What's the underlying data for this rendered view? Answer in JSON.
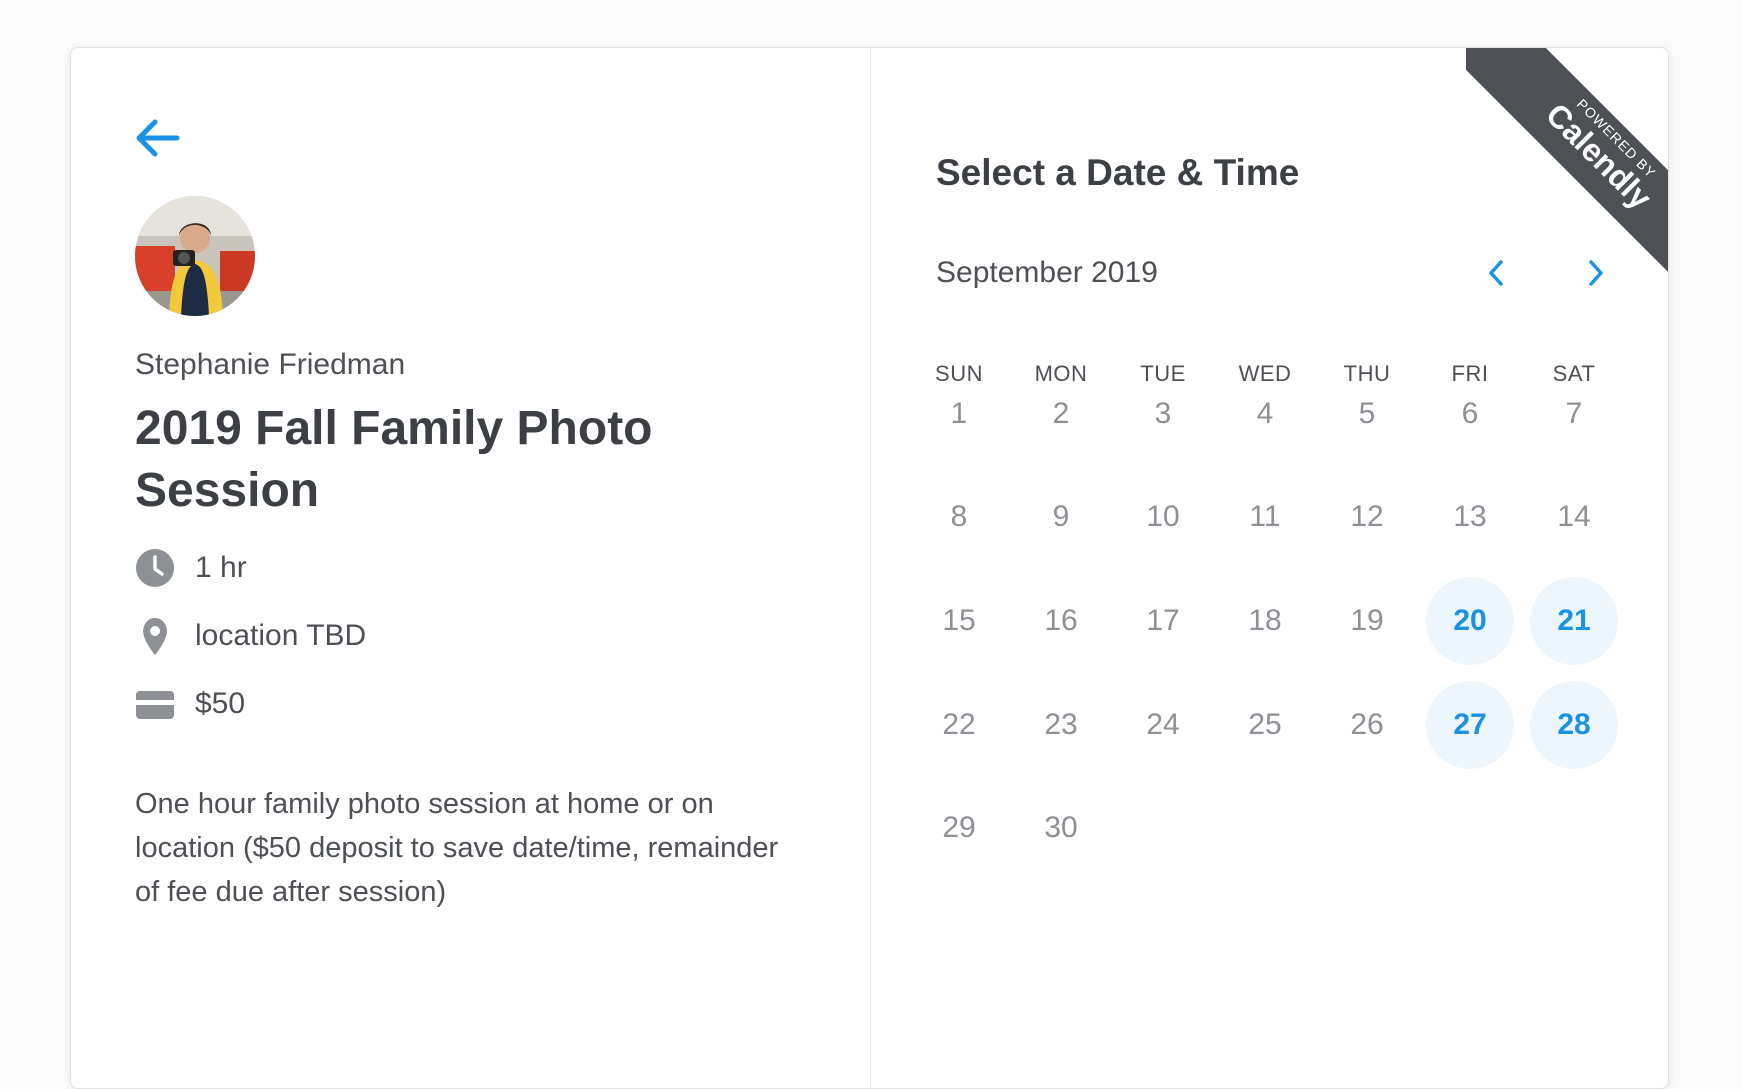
{
  "host": {
    "name": "Stephanie Friedman"
  },
  "event": {
    "title": "2019 Fall Family Photo Session",
    "duration": "1 hr",
    "location": "location TBD",
    "price": "$50",
    "description": "One hour family photo session at home or on location ($50 deposit to save date/time, remainder of fee due after session)"
  },
  "scheduler": {
    "title": "Select a Date & Time",
    "month": "September 2019",
    "weekdays": [
      "SUN",
      "MON",
      "TUE",
      "WED",
      "THU",
      "FRI",
      "SAT"
    ],
    "days": [
      "1",
      "2",
      "3",
      "4",
      "5",
      "6",
      "7",
      "8",
      "9",
      "10",
      "11",
      "12",
      "13",
      "14",
      "15",
      "16",
      "17",
      "18",
      "19",
      "20",
      "21",
      "22",
      "23",
      "24",
      "25",
      "26",
      "27",
      "28",
      "29",
      "30"
    ],
    "available_days": [
      "20",
      "21",
      "27",
      "28"
    ]
  },
  "branding": {
    "powered_by": "POWERED BY",
    "brand": "Calendly"
  },
  "colors": {
    "accent": "#1a93e6",
    "available_bg": "#eef6fd",
    "ribbon": "#4d5055",
    "text": "#4d5055"
  },
  "icons": {
    "back": "arrow-left-icon",
    "prev": "chevron-left-icon",
    "next": "chevron-right-icon",
    "duration": "clock-icon",
    "location": "map-pin-icon",
    "price": "credit-card-icon"
  }
}
